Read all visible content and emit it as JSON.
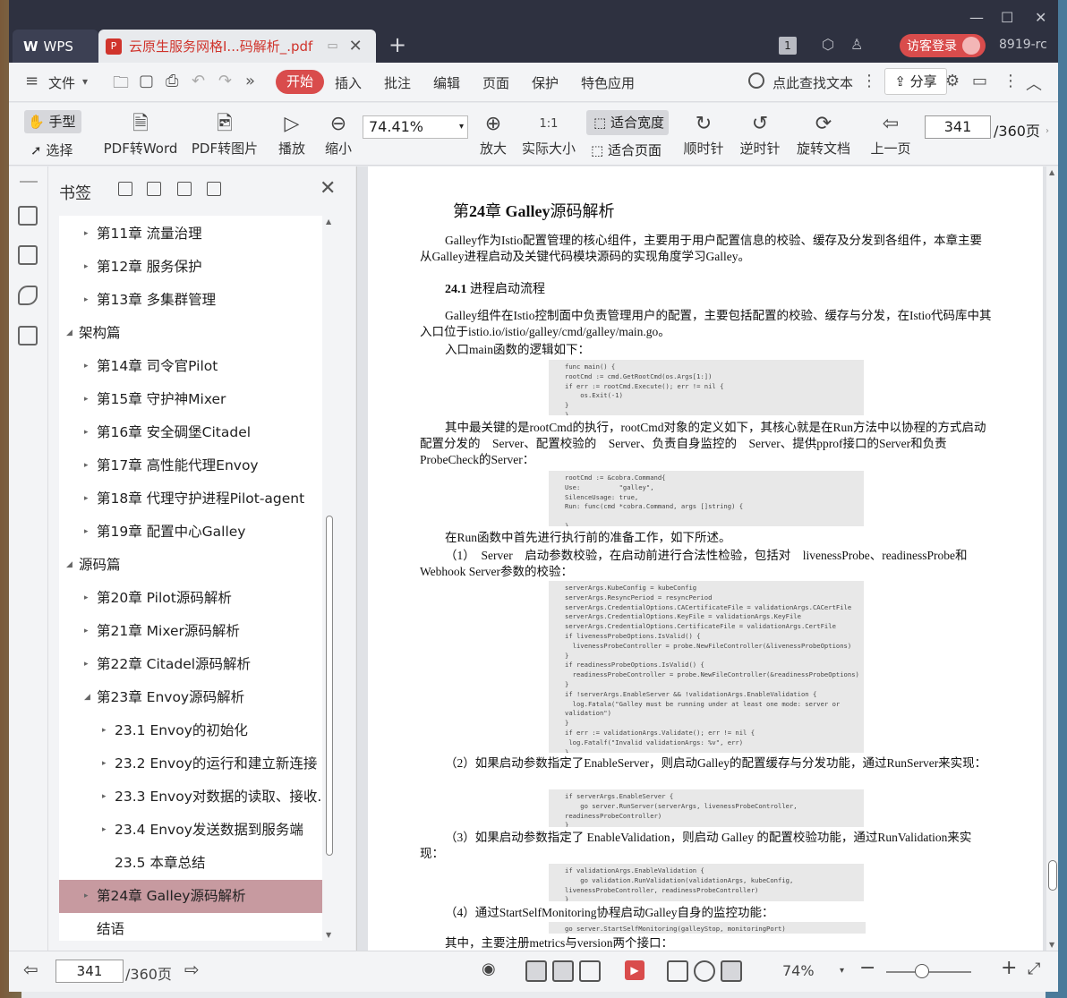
{
  "window": {
    "min": "—",
    "max": "☐",
    "close": "✕"
  },
  "tabs": {
    "wps": "WPS",
    "doc_title": "云原生服务网格I...码解析_.pdf"
  },
  "titlebar": {
    "page_badge": "1",
    "login": "访客登录",
    "version": "8919-rc"
  },
  "menu": {
    "file": "文件",
    "items": [
      "开始",
      "插入",
      "批注",
      "编辑",
      "页面",
      "保护",
      "特色应用"
    ],
    "search": "点此查找文本",
    "share": "分享"
  },
  "toolbar": {
    "hand": "手型",
    "select": "选择",
    "pdf_word": "PDF转Word",
    "pdf_image": "PDF转图片",
    "play": "播放",
    "zoom_out": "缩小",
    "zoom_value": "74.41%",
    "zoom_in": "放大",
    "actual_size": "实际大小",
    "fit_width": "适合宽度",
    "fit_page": "适合页面",
    "clockwise": "顺时针",
    "counterclockwise": "逆时针",
    "rotate_doc": "旋转文档",
    "prev_page": "上一页",
    "page_current": "341",
    "page_total": "/360页"
  },
  "bookmarks": {
    "title": "书签",
    "items": [
      {
        "label": "第11章 流量治理",
        "level": 2,
        "state": "collapsed"
      },
      {
        "label": "第12章 服务保护",
        "level": 2,
        "state": "collapsed"
      },
      {
        "label": "第13章 多集群管理",
        "level": 2,
        "state": "collapsed"
      },
      {
        "label": "架构篇",
        "level": 1,
        "state": "expanded"
      },
      {
        "label": "第14章 司令官Pilot",
        "level": 2,
        "state": "collapsed"
      },
      {
        "label": "第15章 守护神Mixer",
        "level": 2,
        "state": "collapsed"
      },
      {
        "label": "第16章 安全碉堡Citadel",
        "level": 2,
        "state": "collapsed"
      },
      {
        "label": "第17章 高性能代理Envoy",
        "level": 2,
        "state": "collapsed"
      },
      {
        "label": "第18章 代理守护进程Pilot-agent",
        "level": 2,
        "state": "collapsed"
      },
      {
        "label": "第19章 配置中心Galley",
        "level": 2,
        "state": "collapsed"
      },
      {
        "label": "源码篇",
        "level": 1,
        "state": "expanded"
      },
      {
        "label": "第20章 Pilot源码解析",
        "level": 2,
        "state": "collapsed"
      },
      {
        "label": "第21章 Mixer源码解析",
        "level": 2,
        "state": "collapsed"
      },
      {
        "label": "第22章 Citadel源码解析",
        "level": 2,
        "state": "collapsed"
      },
      {
        "label": "第23章 Envoy源码解析",
        "level": 2,
        "state": "expanded"
      },
      {
        "label": "23.1 Envoy的初始化",
        "level": 3,
        "state": "collapsed"
      },
      {
        "label": "23.2 Envoy的运行和建立新连接",
        "level": 3,
        "state": "collapsed"
      },
      {
        "label": "23.3 Envoy对数据的读取、接收...",
        "level": 3,
        "state": "collapsed"
      },
      {
        "label": "23.4 Envoy发送数据到服务端",
        "level": 3,
        "state": "collapsed"
      },
      {
        "label": "23.5 本章总结",
        "level": 3,
        "state": "leaf"
      },
      {
        "label": "第24章 Galley源码解析",
        "level": 2,
        "state": "selected"
      },
      {
        "label": "结语",
        "level": 2,
        "state": "leaf"
      }
    ]
  },
  "document": {
    "chapter_num": "第",
    "chapter_bold": "24",
    "chapter_mid": "章",
    "chapter_name": "Galley",
    "chapter_rest": "源码解析",
    "intro": "Galley作为Istio配置管理的核心组件，主要用于用户配置信息的校验、缓存及分发到各组件，本章主要从Galley进程启动及关键代码模块源码的实现角度学习Galley。",
    "section_num": "24.1",
    "section_title": "进程启动流程",
    "p1": "Galley组件在Istio控制面中负责管理用户的配置，主要包括配置的校验、缓存与分发，在Istio代码库中其入口位于istio.io/istio/galley/cmd/galley/main.go。",
    "p2": "入口main函数的逻辑如下：",
    "code1": "func main() {\nrootCmd := cmd.GetRootCmd(os.Args[1:])\nif err := rootCmd.Execute(); err != nil {\n    os.Exit(-1)\n}\n}",
    "p3": "其中最关键的是rootCmd的执行，rootCmd对象的定义如下，其核心就是在Run方法中以协程的方式启动配置分发的　Server、配置校验的　Server、负责自身监控的　Server、提供pprof接口的Server和负责ProbeCheck的Server：",
    "code2": "rootCmd := &cobra.Command{\nUse:          \"galley\",\nSilenceUsage: true,\nRun: func(cmd *cobra.Command, args []string) {\n\n}",
    "p4": "在Run函数中首先进行执行前的准备工作，如下所述。",
    "p5": "（1）　Server　启动参数校验，在启动前进行合法性检验，包括对　livenessProbe、readinessProbe和Webhook Server参数的校验：",
    "code3": "serverArgs.KubeConfig = kubeConfig\nserverArgs.ResyncPeriod = resyncPeriod\nserverArgs.CredentialOptions.CACertificateFile = validationArgs.CACertFile\nserverArgs.CredentialOptions.KeyFile = validationArgs.KeyFile\nserverArgs.CredentialOptions.CertificateFile = validationArgs.CertFile\nif livenessProbeOptions.IsValid() {\n  livenessProbeController = probe.NewFileController(&livenessProbeOptions)\n}\nif readinessProbeOptions.IsValid() {\n  readinessProbeController = probe.NewFileController(&readinessProbeOptions)\n}\nif !serverArgs.EnableServer && !validationArgs.EnableValidation {\n  log.Fatala(\"Galley must be running under at least one mode: server or\nvalidation\")\n}\nif err := validationArgs.Validate(); err != nil {\n log.Fatalf(\"Invalid validationArgs: %v\", err)\n}",
    "p6": "（2）如果启动参数指定了EnableServer，则启动Galley的配置缓存与分发功能，通过RunServer来实现：",
    "code4": "if serverArgs.EnableServer {\n    go server.RunServer(serverArgs, livenessProbeController,\nreadinessProbeController)\n}",
    "p7": "（3）如果启动参数指定了 EnableValidation，则启动 Galley 的配置校验功能，通过RunValidation来实现：",
    "code5": "if validationArgs.EnableValidation {\n    go validation.RunValidation(validationArgs, kubeConfig,\nlivenessProbeController, readinessProbeController)\n}",
    "p8": "（4）通过StartSelfMonitoring协程启动Galley自身的监控功能：",
    "code6": "go server.StartSelfMonitoring(galleyStop, monitoringPort)",
    "p9": "其中，主要注册metrics与version两个接口："
  },
  "statusbar": {
    "page_current": "341",
    "page_total": "/360页",
    "zoom": "74%"
  }
}
